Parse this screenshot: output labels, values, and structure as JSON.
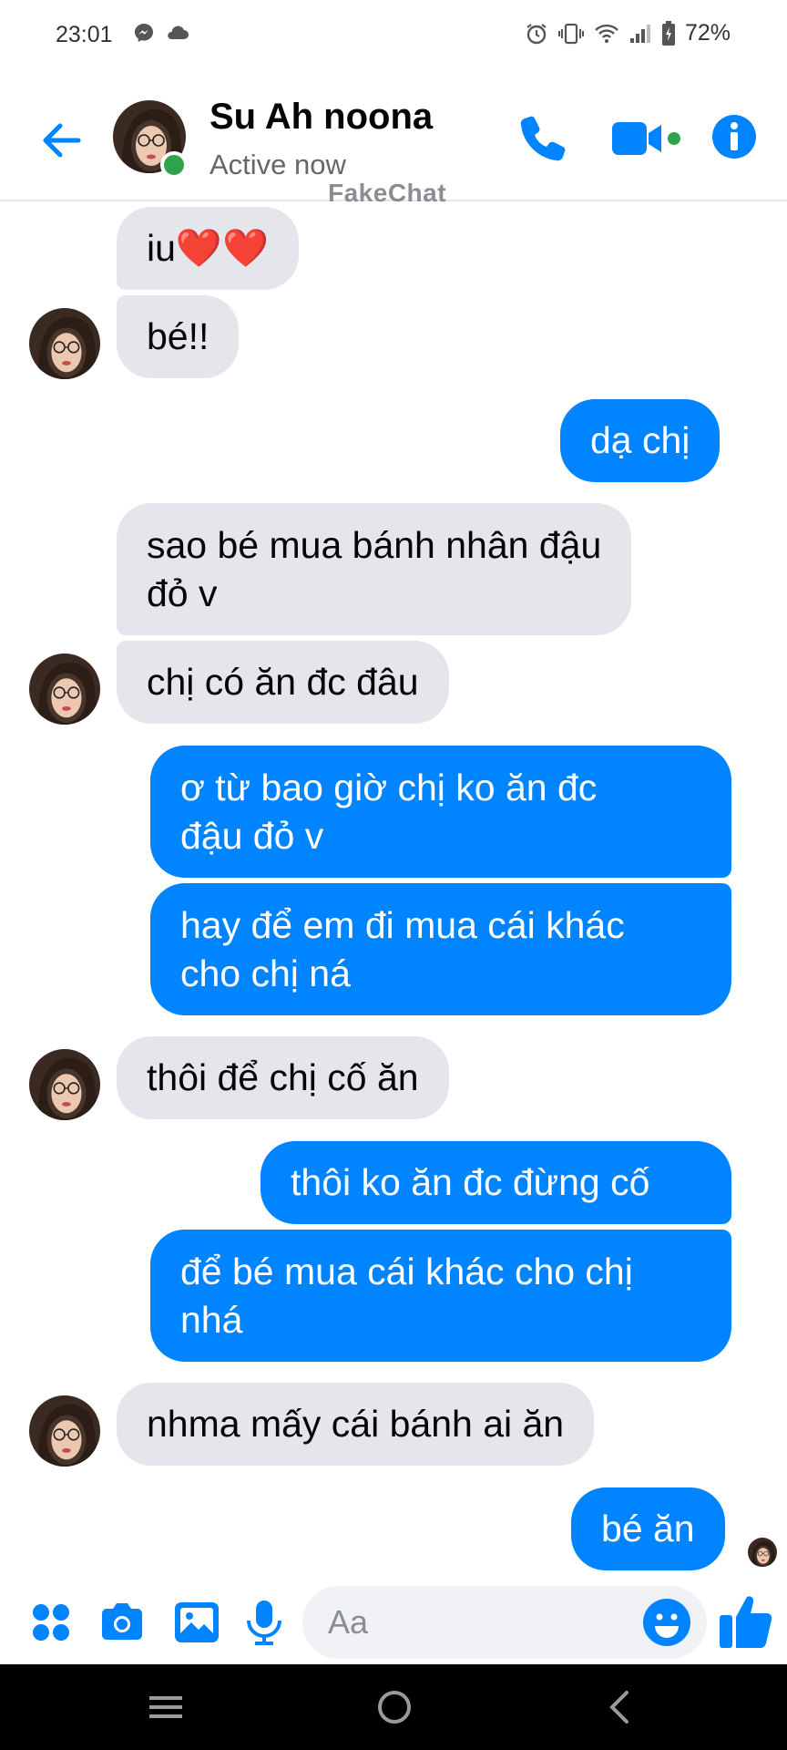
{
  "status_bar": {
    "time": "23:01",
    "battery": "72%"
  },
  "header": {
    "name": "Su Ah noona",
    "status": "Active now",
    "watermark": "FakeChat"
  },
  "messages": [
    {
      "from": "them",
      "text": "iu❤️❤️"
    },
    {
      "from": "them",
      "text": "bé!!"
    },
    {
      "from": "me",
      "text": "dạ chị"
    },
    {
      "from": "them",
      "text": "sao bé mua bánh nhân đậu\nđỏ v"
    },
    {
      "from": "them",
      "text": "chị có ăn đc đâu"
    },
    {
      "from": "me",
      "text": "ơ từ bao giờ chị ko ăn đc\nđậu đỏ v"
    },
    {
      "from": "me",
      "text": "hay để em đi mua cái khác\ncho chị ná"
    },
    {
      "from": "them",
      "text": "thôi để chị cố ăn"
    },
    {
      "from": "me",
      "text": "thôi ko ăn đc đừng cố"
    },
    {
      "from": "me",
      "text": "để bé mua cái khác cho chị\nnhá"
    },
    {
      "from": "them",
      "text": "nhma mấy cái bánh ai ăn"
    },
    {
      "from": "me",
      "text": "bé ăn"
    }
  ],
  "composer": {
    "placeholder": "Aa"
  },
  "colors": {
    "accent": "#0084ff",
    "incoming": "#e4e6eb",
    "online": "#31a24c"
  },
  "icons": {
    "status": [
      "messenger-icon",
      "cloud-icon",
      "alarm-icon",
      "vibrate-icon",
      "wifi-icon",
      "signal-icon",
      "battery-icon"
    ],
    "header": [
      "back-arrow-icon",
      "phone-icon",
      "video-camera-icon",
      "info-icon"
    ],
    "composer": [
      "apps-grid-icon",
      "camera-icon",
      "gallery-icon",
      "microphone-icon",
      "emoji-icon",
      "thumbs-up-icon"
    ],
    "nav": [
      "recents-icon",
      "home-icon",
      "back-icon"
    ]
  }
}
